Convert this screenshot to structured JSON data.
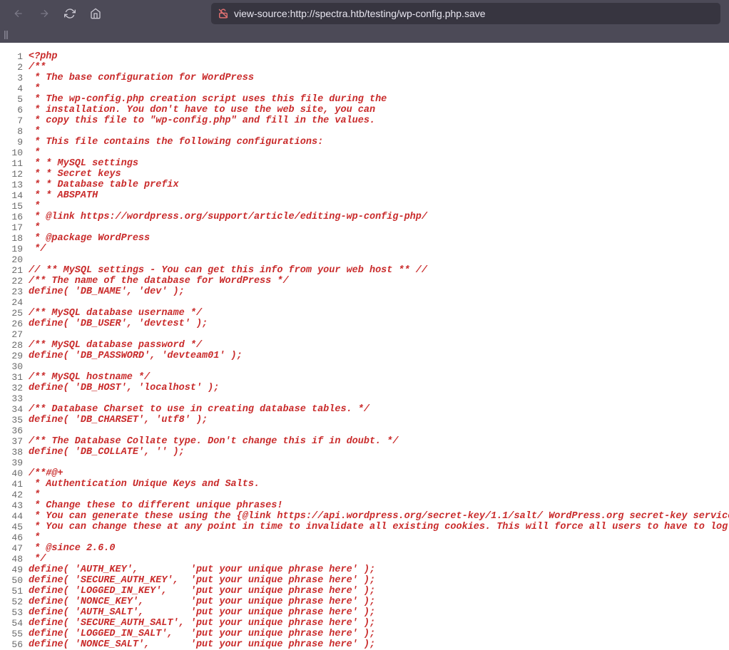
{
  "browser": {
    "url": "view-source:http://spectra.htb/testing/wp-config.php.save"
  },
  "source": {
    "lines": [
      "<?php",
      "/**",
      " * The base configuration for WordPress",
      " *",
      " * The wp-config.php creation script uses this file during the",
      " * installation. You don't have to use the web site, you can",
      " * copy this file to \"wp-config.php\" and fill in the values.",
      " *",
      " * This file contains the following configurations:",
      " *",
      " * * MySQL settings",
      " * * Secret keys",
      " * * Database table prefix",
      " * * ABSPATH",
      " *",
      " * @link https://wordpress.org/support/article/editing-wp-config-php/",
      " *",
      " * @package WordPress",
      " */",
      "",
      "// ** MySQL settings - You can get this info from your web host ** //",
      "/** The name of the database for WordPress */",
      "define( 'DB_NAME', 'dev' );",
      "",
      "/** MySQL database username */",
      "define( 'DB_USER', 'devtest' );",
      "",
      "/** MySQL database password */",
      "define( 'DB_PASSWORD', 'devteam01' );",
      "",
      "/** MySQL hostname */",
      "define( 'DB_HOST', 'localhost' );",
      "",
      "/** Database Charset to use in creating database tables. */",
      "define( 'DB_CHARSET', 'utf8' );",
      "",
      "/** The Database Collate type. Don't change this if in doubt. */",
      "define( 'DB_COLLATE', '' );",
      "",
      "/**#@+",
      " * Authentication Unique Keys and Salts.",
      " *",
      " * Change these to different unique phrases!",
      " * You can generate these using the {@link https://api.wordpress.org/secret-key/1.1/salt/ WordPress.org secret-key service}",
      " * You can change these at any point in time to invalidate all existing cookies. This will force all users to have to log in again.",
      " *",
      " * @since 2.6.0",
      " */",
      "define( 'AUTH_KEY',         'put your unique phrase here' );",
      "define( 'SECURE_AUTH_KEY',  'put your unique phrase here' );",
      "define( 'LOGGED_IN_KEY',    'put your unique phrase here' );",
      "define( 'NONCE_KEY',        'put your unique phrase here' );",
      "define( 'AUTH_SALT',        'put your unique phrase here' );",
      "define( 'SECURE_AUTH_SALT', 'put your unique phrase here' );",
      "define( 'LOGGED_IN_SALT',   'put your unique phrase here' );",
      "define( 'NONCE_SALT',       'put your unique phrase here' );"
    ]
  }
}
